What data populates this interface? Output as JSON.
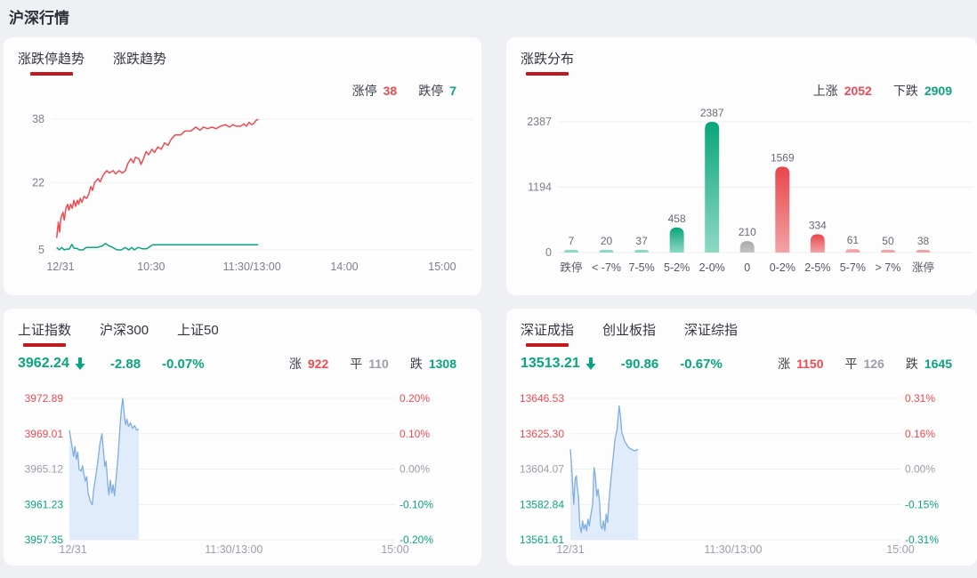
{
  "page": {
    "title": "沪深行情"
  },
  "colors": {
    "red": "#ef4a50",
    "green": "#0aa57e",
    "gray": "#9a9ea6",
    "underline": "#c11920",
    "bar_green": "#0aa57c",
    "bar_green_light": "#8ed8c3",
    "bar_red": "#e8464b",
    "bar_red_light": "#f2a3a5",
    "bar_gray": "#a9a9a9",
    "bar_gray_light": "#c2c2c2",
    "line_blue": "#7fadde",
    "fill_blue": "#dbe9fb",
    "axis_text": "#7c7f87",
    "axis_text_light": "#9ba0a8",
    "grid": "#efefef",
    "label_text": "#666a72"
  },
  "panel1": {
    "tabs": [
      {
        "label": "涨跌停趋势",
        "active": true
      },
      {
        "label": "涨跌趋势",
        "active": false
      }
    ],
    "stats": [
      {
        "label": "涨停",
        "value": "38",
        "color": "red"
      },
      {
        "label": "跌停",
        "value": "7",
        "color": "green"
      }
    ]
  },
  "panel2": {
    "tabs": [
      {
        "label": "涨跌分布",
        "active": true
      }
    ],
    "stats": [
      {
        "label": "上涨",
        "value": "2052",
        "color": "red"
      },
      {
        "label": "下跌",
        "value": "2909",
        "color": "green"
      }
    ]
  },
  "panel3": {
    "tabs": [
      {
        "label": "上证指数",
        "active": true
      },
      {
        "label": "沪深300",
        "active": false
      },
      {
        "label": "上证50",
        "active": false
      }
    ],
    "index": {
      "value": "3962.24",
      "change": "-2.88",
      "pct": "-0.07%",
      "color": "green",
      "direction": "down"
    },
    "stats": [
      {
        "label": "涨",
        "value": "922",
        "color": "red"
      },
      {
        "label": "平",
        "value": "110",
        "color": "gray"
      },
      {
        "label": "跌",
        "value": "1308",
        "color": "green"
      }
    ]
  },
  "panel4": {
    "tabs": [
      {
        "label": "深证成指",
        "active": true
      },
      {
        "label": "创业板指",
        "active": false
      },
      {
        "label": "深证综指",
        "active": false
      }
    ],
    "index": {
      "value": "13513.21",
      "change": "-90.86",
      "pct": "-0.67%",
      "color": "green",
      "direction": "down"
    },
    "stats": [
      {
        "label": "涨",
        "value": "1150",
        "color": "red"
      },
      {
        "label": "平",
        "value": "126",
        "color": "gray"
      },
      {
        "label": "跌",
        "value": "1645",
        "color": "green"
      }
    ]
  },
  "chart_data": [
    {
      "mount": "c1",
      "type": "line",
      "title": "涨跌停趋势",
      "y_ticks": [
        38,
        22,
        5
      ],
      "ylim": [
        5,
        38
      ],
      "x_ticks": [
        "12/31",
        "10:30",
        "11:30/13:00",
        "14:00",
        "15:00"
      ],
      "grid": true,
      "legend_position": "none",
      "series": [
        {
          "name": "涨停",
          "color": "red",
          "points": [
            [
              0.012,
              8
            ],
            [
              0.016,
              12
            ],
            [
              0.019,
              9.5
            ],
            [
              0.022,
              13
            ],
            [
              0.027,
              14.5
            ],
            [
              0.03,
              12.5
            ],
            [
              0.034,
              15.5
            ],
            [
              0.038,
              16.5
            ],
            [
              0.041,
              15
            ],
            [
              0.045,
              16.5
            ],
            [
              0.049,
              15.5
            ],
            [
              0.053,
              17.5
            ],
            [
              0.057,
              16
            ],
            [
              0.061,
              17.5
            ],
            [
              0.064,
              16.5
            ],
            [
              0.068,
              18
            ],
            [
              0.072,
              17
            ],
            [
              0.077,
              18.5
            ],
            [
              0.083,
              18
            ],
            [
              0.088,
              19
            ],
            [
              0.093,
              21
            ],
            [
              0.097,
              20
            ],
            [
              0.102,
              22
            ],
            [
              0.11,
              23
            ],
            [
              0.115,
              22.2
            ],
            [
              0.123,
              24
            ],
            [
              0.131,
              25
            ],
            [
              0.137,
              24.4
            ],
            [
              0.146,
              25
            ],
            [
              0.152,
              24.2
            ],
            [
              0.16,
              25
            ],
            [
              0.168,
              24.4
            ],
            [
              0.175,
              25
            ],
            [
              0.181,
              26.8
            ],
            [
              0.188,
              28
            ],
            [
              0.194,
              27
            ],
            [
              0.199,
              28.4
            ],
            [
              0.207,
              28
            ],
            [
              0.212,
              26.6
            ],
            [
              0.218,
              28
            ],
            [
              0.224,
              29.8
            ],
            [
              0.23,
              29
            ],
            [
              0.238,
              30.4
            ],
            [
              0.244,
              29.6
            ],
            [
              0.252,
              31
            ],
            [
              0.26,
              30.4
            ],
            [
              0.268,
              32
            ],
            [
              0.276,
              31.4
            ],
            [
              0.284,
              33
            ],
            [
              0.293,
              34
            ],
            [
              0.306,
              34
            ],
            [
              0.316,
              35
            ],
            [
              0.33,
              35
            ],
            [
              0.342,
              36
            ],
            [
              0.352,
              35.2
            ],
            [
              0.36,
              36
            ],
            [
              0.37,
              35.6
            ],
            [
              0.38,
              36
            ],
            [
              0.39,
              35.6
            ],
            [
              0.4,
              36.2
            ],
            [
              0.412,
              36.6
            ],
            [
              0.422,
              36
            ],
            [
              0.43,
              36.6
            ],
            [
              0.438,
              36.2
            ],
            [
              0.448,
              36.2
            ],
            [
              0.456,
              36.8
            ],
            [
              0.462,
              36.2
            ],
            [
              0.468,
              37.2
            ],
            [
              0.474,
              36.6
            ],
            [
              0.48,
              37
            ],
            [
              0.484,
              37.6
            ],
            [
              0.49,
              38
            ]
          ]
        },
        {
          "name": "跌停",
          "color": "green",
          "points": [
            [
              0.012,
              5.6
            ],
            [
              0.018,
              5
            ],
            [
              0.024,
              5.6
            ],
            [
              0.03,
              5
            ],
            [
              0.036,
              5.2
            ],
            [
              0.042,
              5.2
            ],
            [
              0.048,
              6.4
            ],
            [
              0.053,
              5.4
            ],
            [
              0.06,
              5.4
            ],
            [
              0.066,
              5
            ],
            [
              0.074,
              5
            ],
            [
              0.082,
              5.6
            ],
            [
              0.095,
              5.6
            ],
            [
              0.108,
              5.6
            ],
            [
              0.12,
              6
            ],
            [
              0.128,
              6.6
            ],
            [
              0.136,
              6
            ],
            [
              0.145,
              5.6
            ],
            [
              0.155,
              5
            ],
            [
              0.165,
              5
            ],
            [
              0.175,
              5.6
            ],
            [
              0.183,
              5
            ],
            [
              0.19,
              5.6
            ],
            [
              0.196,
              5
            ],
            [
              0.205,
              5.6
            ],
            [
              0.215,
              5.3
            ],
            [
              0.225,
              5.3
            ],
            [
              0.24,
              6.3
            ],
            [
              0.49,
              6.3
            ]
          ]
        }
      ]
    },
    {
      "mount": "c2",
      "type": "bar",
      "title": "涨跌分布",
      "y_ticks": [
        2387,
        1194,
        0
      ],
      "ylim": [
        0,
        2387
      ],
      "categories": [
        "跌停",
        "< -7%",
        "7-5%",
        "5-2%",
        "2-0%",
        "0",
        "0-2%",
        "2-5%",
        "5-7%",
        "> 7%",
        "涨停"
      ],
      "values": [
        7,
        20,
        37,
        458,
        2387,
        210,
        1569,
        334,
        61,
        50,
        38
      ],
      "bar_colors": [
        "green",
        "green",
        "green",
        "green",
        "green",
        "gray",
        "red",
        "red",
        "red",
        "red",
        "red"
      ],
      "grid": true
    },
    {
      "mount": "c3",
      "type": "area",
      "title": "上证指数分时",
      "left_ticks": [
        {
          "label": "3972.89",
          "color": "red"
        },
        {
          "label": "3969.01",
          "color": "red"
        },
        {
          "label": "3965.12",
          "color": "gray"
        },
        {
          "label": "3961.23",
          "color": "green"
        },
        {
          "label": "3957.35",
          "color": "green"
        }
      ],
      "right_ticks": [
        {
          "label": "0.20%",
          "color": "red"
        },
        {
          "label": "0.10%",
          "color": "red"
        },
        {
          "label": "0.00%",
          "color": "gray"
        },
        {
          "label": "-0.10%",
          "color": "green"
        },
        {
          "label": "-0.20%",
          "color": "green"
        }
      ],
      "ylim": [
        3957.35,
        3972.89
      ],
      "x_ticks": [
        "12/31",
        "11:30/13:00",
        "15:00"
      ],
      "x_extent": 0.213,
      "grid": true,
      "points": [
        [
          0.0,
          3969.4
        ],
        [
          0.03,
          3968.0
        ],
        [
          0.06,
          3966.5
        ],
        [
          0.08,
          3967.6
        ],
        [
          0.1,
          3966.2
        ],
        [
          0.12,
          3967.0
        ],
        [
          0.14,
          3965.1
        ],
        [
          0.17,
          3964.9
        ],
        [
          0.19,
          3965.5
        ],
        [
          0.21,
          3964.5
        ],
        [
          0.23,
          3963.8
        ],
        [
          0.25,
          3964.3
        ],
        [
          0.27,
          3962.5
        ],
        [
          0.3,
          3961.6
        ],
        [
          0.33,
          3961.2
        ],
        [
          0.35,
          3962.9
        ],
        [
          0.38,
          3964.3
        ],
        [
          0.41,
          3966.0
        ],
        [
          0.44,
          3967.9
        ],
        [
          0.47,
          3969.0
        ],
        [
          0.49,
          3967.2
        ],
        [
          0.51,
          3965.4
        ],
        [
          0.53,
          3966.0
        ],
        [
          0.55,
          3963.7
        ],
        [
          0.57,
          3962.3
        ],
        [
          0.59,
          3963.9
        ],
        [
          0.61,
          3962.5
        ],
        [
          0.63,
          3963.4
        ],
        [
          0.65,
          3962.2
        ],
        [
          0.67,
          3963.8
        ],
        [
          0.69,
          3965.5
        ],
        [
          0.71,
          3967.5
        ],
        [
          0.73,
          3969.8
        ],
        [
          0.75,
          3971.8
        ],
        [
          0.77,
          3972.89
        ],
        [
          0.79,
          3971.2
        ],
        [
          0.81,
          3970.0
        ],
        [
          0.83,
          3970.6
        ],
        [
          0.85,
          3969.8
        ],
        [
          0.88,
          3970.2
        ],
        [
          0.91,
          3969.6
        ],
        [
          0.94,
          3969.9
        ],
        [
          0.97,
          3969.4
        ],
        [
          1.0,
          3969.5
        ]
      ]
    },
    {
      "mount": "c4",
      "type": "area",
      "title": "深证成指分时",
      "left_ticks": [
        {
          "label": "13646.53",
          "color": "red"
        },
        {
          "label": "13625.30",
          "color": "red"
        },
        {
          "label": "13604.07",
          "color": "gray"
        },
        {
          "label": "13582.84",
          "color": "green"
        },
        {
          "label": "13561.61",
          "color": "green"
        }
      ],
      "right_ticks": [
        {
          "label": "0.31%",
          "color": "red"
        },
        {
          "label": "0.16%",
          "color": "red"
        },
        {
          "label": "0.00%",
          "color": "gray"
        },
        {
          "label": "-0.15%",
          "color": "green"
        },
        {
          "label": "-0.31%",
          "color": "green"
        }
      ],
      "ylim": [
        13561.61,
        13646.53
      ],
      "x_ticks": [
        "12/31",
        "11:30/13:00",
        "15:00"
      ],
      "x_extent": 0.205,
      "grid": true,
      "points": [
        [
          0.0,
          13616
        ],
        [
          0.02,
          13605
        ],
        [
          0.04,
          13590
        ],
        [
          0.05,
          13583
        ],
        [
          0.07,
          13598
        ],
        [
          0.09,
          13600
        ],
        [
          0.1,
          13594
        ],
        [
          0.12,
          13588
        ],
        [
          0.14,
          13570
        ],
        [
          0.16,
          13566
        ],
        [
          0.18,
          13573
        ],
        [
          0.2,
          13568
        ],
        [
          0.22,
          13571
        ],
        [
          0.24,
          13567
        ],
        [
          0.26,
          13574
        ],
        [
          0.28,
          13570
        ],
        [
          0.3,
          13576
        ],
        [
          0.33,
          13583
        ],
        [
          0.35,
          13605
        ],
        [
          0.37,
          13600
        ],
        [
          0.39,
          13588
        ],
        [
          0.41,
          13592
        ],
        [
          0.43,
          13585
        ],
        [
          0.45,
          13570
        ],
        [
          0.47,
          13568
        ],
        [
          0.49,
          13573
        ],
        [
          0.51,
          13567
        ],
        [
          0.53,
          13577
        ],
        [
          0.55,
          13572
        ],
        [
          0.57,
          13585
        ],
        [
          0.6,
          13598
        ],
        [
          0.63,
          13610
        ],
        [
          0.66,
          13622
        ],
        [
          0.69,
          13628
        ],
        [
          0.72,
          13642
        ],
        [
          0.74,
          13636
        ],
        [
          0.76,
          13626
        ],
        [
          0.78,
          13624
        ],
        [
          0.8,
          13621
        ],
        [
          0.83,
          13619
        ],
        [
          0.86,
          13617
        ],
        [
          0.9,
          13616
        ],
        [
          0.95,
          13615
        ],
        [
          1.0,
          13616
        ]
      ]
    }
  ]
}
